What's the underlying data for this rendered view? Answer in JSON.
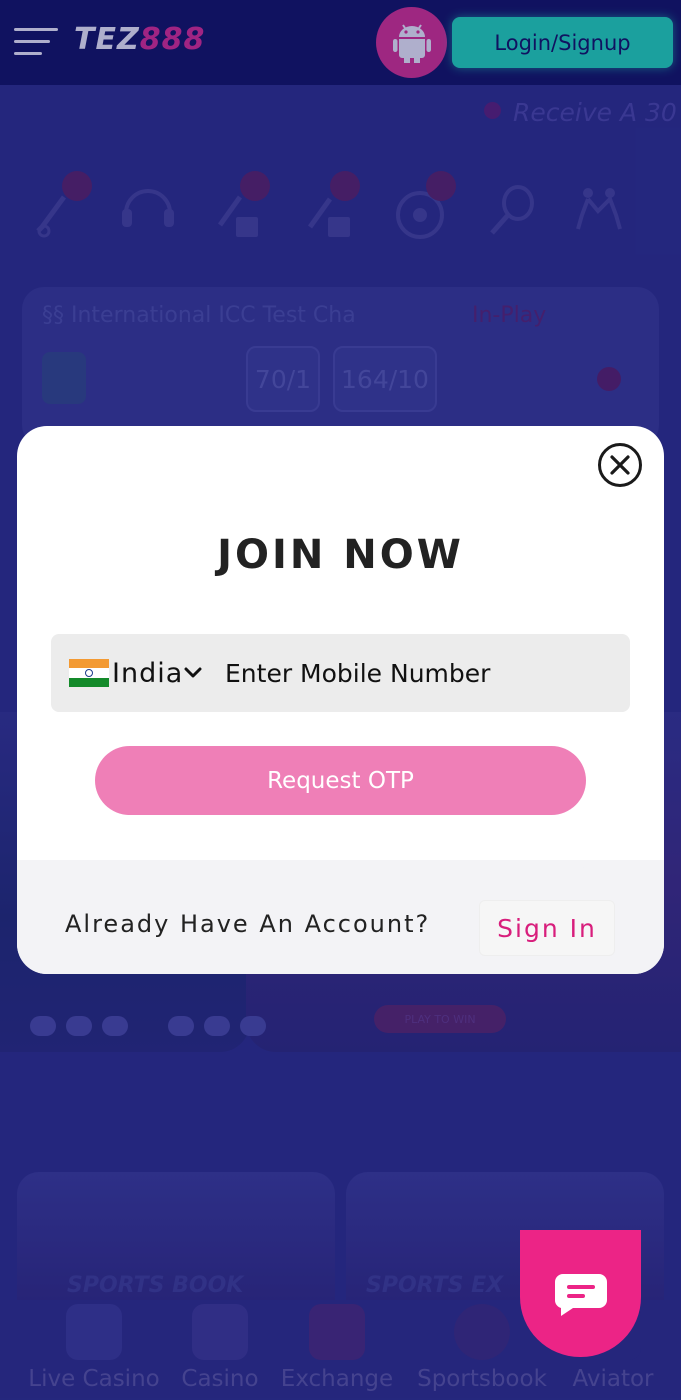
{
  "header": {
    "logo_part1": "TEZ",
    "logo_part2": "888",
    "login_label": "Login/Signup"
  },
  "ticker": {
    "text": "Receive A 30"
  },
  "match": {
    "title": "§§ International ICC Test Cha",
    "status": "In-Play",
    "score1": "70/1",
    "score2": "164/10"
  },
  "banner": {
    "play_label": "PLAY TO WIN"
  },
  "tiles": [
    {
      "label": "SPORTS BOOK"
    },
    {
      "label": "SPORTS EX"
    }
  ],
  "bottom_nav": [
    {
      "label": "Live Casino",
      "icon": "live-casino-icon"
    },
    {
      "label": "Casino",
      "icon": "casino-icon"
    },
    {
      "label": "Exchange",
      "icon": "exchange-icon"
    },
    {
      "label": "Sportsbook",
      "icon": "sportsbook-icon"
    },
    {
      "label": "Aviator",
      "icon": "aviator-icon"
    }
  ],
  "modal": {
    "title": "JOIN NOW",
    "country": "India",
    "mobile_placeholder": "Enter Mobile Number",
    "otp_label": "Request OTP",
    "account_prompt": "Already Have An Account?",
    "signin_label": "Sign In"
  },
  "colors": {
    "header_bg": "#0c0f5a",
    "accent_pink": "#e92a8f",
    "accent_teal": "#1de8b8",
    "otp_button": "#ef7fb7"
  }
}
